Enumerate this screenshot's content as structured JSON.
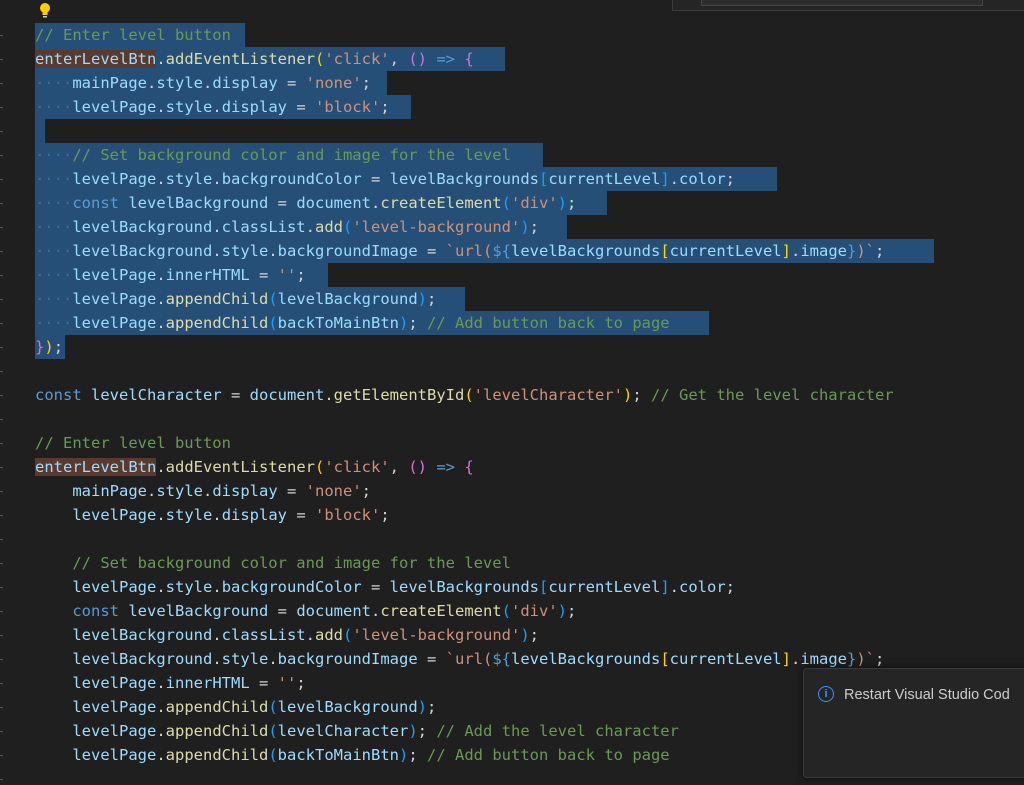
{
  "toast": {
    "icon": "info-icon",
    "message": "Restart Visual Studio Cod"
  },
  "colors": {
    "selection": "#264f78",
    "background": "#1f1f1f",
    "comment": "#6a9955",
    "keyword": "#569cd6",
    "variable": "#9cdcfe",
    "function": "#dcdcaa",
    "string": "#ce9178"
  },
  "code": {
    "b1": {
      "l1": "// Enter level button",
      "l2a": "enterLevelBtn",
      "l2b": "addEventListener",
      "l2c": "'click'",
      "l3a": "mainPage",
      "l3b": "style",
      "l3c": "display",
      "l3d": "'none'",
      "l4a": "levelPage",
      "l4b": "style",
      "l4c": "display",
      "l4d": "'block'",
      "l6": "// Set background color and image for the level",
      "l7a": "levelPage",
      "l7b": "style",
      "l7c": "backgroundColor",
      "l7d": "levelBackgrounds",
      "l7e": "currentLevel",
      "l7f": "color",
      "l8a": "const",
      "l8b": "levelBackground",
      "l8c": "document",
      "l8d": "createElement",
      "l8e": "'div'",
      "l9a": "levelBackground",
      "l9b": "classList",
      "l9c": "add",
      "l9d": "'level-background'",
      "l10a": "levelBackground",
      "l10b": "style",
      "l10c": "backgroundImage",
      "l10d": "`url(",
      "l10e": "levelBackgrounds",
      "l10f": "currentLevel",
      "l10g": "image",
      "l10h": ")`",
      "l11a": "levelPage",
      "l11b": "innerHTML",
      "l11c": "''",
      "l12a": "levelPage",
      "l12b": "appendChild",
      "l12c": "levelBackground",
      "l13a": "levelPage",
      "l13b": "appendChild",
      "l13c": "backToMainBtn",
      "l13d": "// Add button back to page"
    },
    "m": {
      "a": "const",
      "b": "levelCharacter",
      "c": "document",
      "d": "getElementById",
      "e": "'levelCharacter'",
      "f": "// Get the level character"
    },
    "b2": {
      "l1": "// Enter level button",
      "l2a": "enterLevelBtn",
      "l2b": "addEventListener",
      "l2c": "'click'",
      "l3a": "mainPage",
      "l3b": "style",
      "l3c": "display",
      "l3d": "'none'",
      "l4a": "levelPage",
      "l4b": "style",
      "l4c": "display",
      "l4d": "'block'",
      "l6": "// Set background color and image for the level",
      "l7a": "levelPage",
      "l7b": "style",
      "l7c": "backgroundColor",
      "l7d": "levelBackgrounds",
      "l7e": "currentLevel",
      "l7f": "color",
      "l8a": "const",
      "l8b": "levelBackground",
      "l8c": "document",
      "l8d": "createElement",
      "l8e": "'div'",
      "l9a": "levelBackground",
      "l9b": "classList",
      "l9c": "add",
      "l9d": "'level-background'",
      "l10a": "levelBackground",
      "l10b": "style",
      "l10c": "backgroundImage",
      "l10d": "`url(",
      "l10e": "levelBackgrounds",
      "l10f": "currentLevel",
      "l10g": "image",
      "l10h": ")`",
      "l11a": "levelPage",
      "l11b": "innerHTML",
      "l11c": "''",
      "l12a": "levelPage",
      "l12b": "appendChild",
      "l12c": "levelBackground",
      "l13a": "levelPage",
      "l13b": "appendChild",
      "l13c": "levelCharacter",
      "l13d": "// Add the level character",
      "l14a": "levelPage",
      "l14b": "appendChild",
      "l14c": "backToMainBtn",
      "l14d": "// Add button back to page"
    }
  }
}
